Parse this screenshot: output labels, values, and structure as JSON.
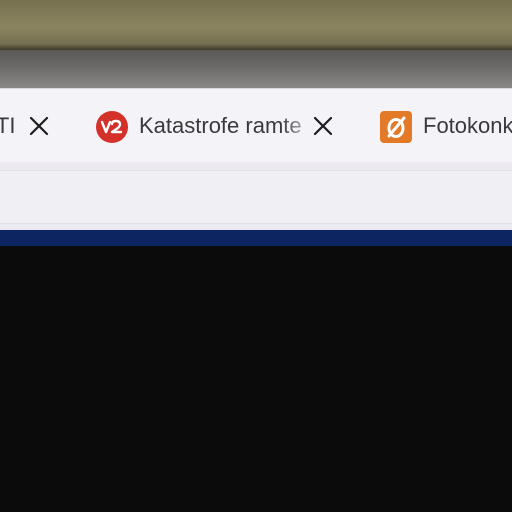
{
  "tabs": [
    {
      "title": "NTI",
      "favicon": "none",
      "close_icon": "close-icon"
    },
    {
      "title": "Katastrofe ramte",
      "favicon": "tv2-icon",
      "favicon_color": "#d3312a",
      "close_icon": "close-icon"
    },
    {
      "title": "Fotokonk",
      "favicon": "oe-logo-icon",
      "favicon_color": "#e37a27"
    }
  ],
  "colors": {
    "tabbar_bg": "#f4f3f7",
    "nav_stripe": "#0d2561",
    "content_bg": "#0b0b0b"
  }
}
